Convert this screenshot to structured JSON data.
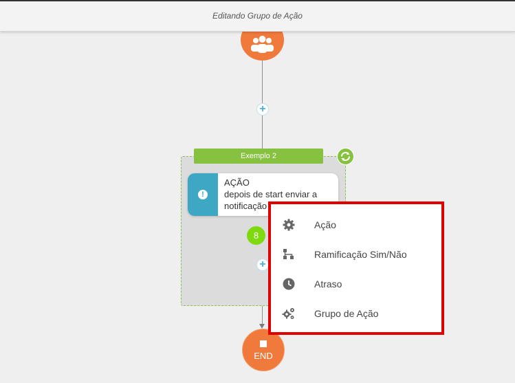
{
  "header": {
    "title": "Editando Grupo de Ação"
  },
  "group": {
    "label": "Exemplo 2"
  },
  "action_card": {
    "title": "AÇÃO",
    "line1": "depois de start enviar a",
    "line2": "notificação"
  },
  "badge": {
    "value": "8"
  },
  "end_node": {
    "label": "END"
  },
  "menu": {
    "items": [
      {
        "label": "Ação",
        "icon": "gear-icon"
      },
      {
        "label": "Ramificação Sim/Não",
        "icon": "branch-icon"
      },
      {
        "label": "Atraso",
        "icon": "clock-icon"
      },
      {
        "label": "Grupo de Ação",
        "icon": "gears-icon"
      }
    ]
  },
  "colors": {
    "orange": "#ef7a3b",
    "green": "#86c140",
    "blue": "#3da7c4",
    "highlight": "#e00000"
  }
}
